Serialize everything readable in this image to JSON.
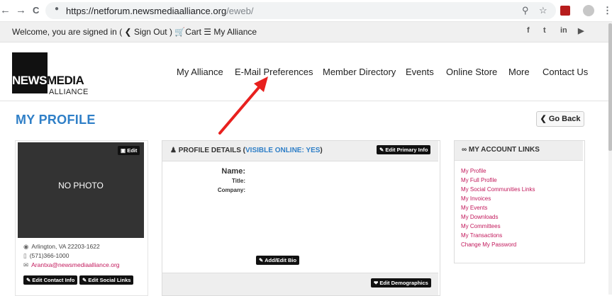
{
  "browser": {
    "url_host": "https://netforum.newsmediaalliance.org",
    "url_path": "/eweb/",
    "back_icon": "←",
    "forward_icon": "→",
    "reload_icon": "C",
    "lock_icon": "🔒"
  },
  "topbar": {
    "welcome_text": "Welcome, you are signed in (",
    "sign_out": "Sign Out",
    "close_paren": ")",
    "cart": "Cart",
    "my_alliance": "My Alliance",
    "social": [
      "f",
      "t",
      "in",
      "▶"
    ]
  },
  "logo": {
    "news": "NEWS",
    "media": "MEDIA",
    "alliance": "ALLIANCE"
  },
  "nav": [
    "My Alliance",
    "E-Mail Preferences",
    "Member Directory",
    "Events",
    "Online Store",
    "More",
    "Contact Us"
  ],
  "page": {
    "title": "MY PROFILE",
    "go_back": "Go Back"
  },
  "left_card": {
    "no_photo": "NO PHOTO",
    "edit_photo": "Edit",
    "address": "Arlington, VA 22203-1622",
    "phone": "(571)366-1000",
    "email": "Arantxa@newsmediaalliance.org",
    "edit_contact": "Edit Contact Info",
    "edit_social": "Edit Social Links"
  },
  "profile_details": {
    "title": "PROFILE DETAILS (",
    "visible": "VISIBLE ONLINE: YES",
    "close": ")",
    "edit_primary": "Edit Primary Info",
    "name_label": "Name:",
    "title_label": "Title:",
    "company_label": "Company:",
    "add_bio": "Add/Edit Bio",
    "edit_demographics": "Edit Demographics"
  },
  "account_links": {
    "title": "MY ACCOUNT LINKS",
    "links": [
      "My Profile",
      "My Full Profile",
      "My Social Communities Links",
      "My Invoices",
      "My Events",
      "My Downloads",
      "My Committees",
      "My Transactions",
      "Change My Password"
    ]
  },
  "colors": {
    "accent_blue": "#2f7fc7",
    "link_pink": "#c2185b",
    "arrow_red": "#e8201e"
  }
}
